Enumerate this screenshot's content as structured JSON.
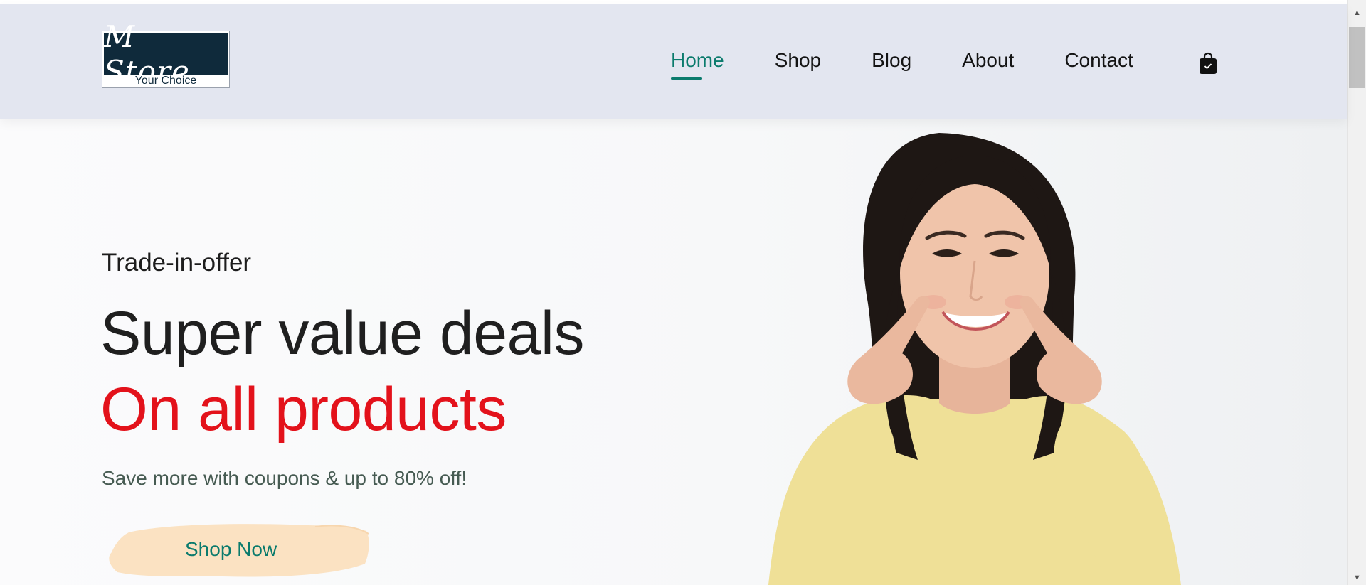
{
  "logo": {
    "name": "M Store",
    "tagline": "Your Choice"
  },
  "nav": {
    "items": [
      {
        "label": "Home",
        "active": true
      },
      {
        "label": "Shop",
        "active": false
      },
      {
        "label": "Blog",
        "active": false
      },
      {
        "label": "About",
        "active": false
      },
      {
        "label": "Contact",
        "active": false
      }
    ],
    "cart_icon": "shopping-bag-icon"
  },
  "hero": {
    "eyebrow": "Trade-in-offer",
    "headline": "Super value deals",
    "headline_accent": "On all products",
    "subtext": "Save more with coupons & up to 80% off!",
    "cta_label": "Shop Now"
  },
  "colors": {
    "accent": "#0b7b6d",
    "highlight": "#e3121b",
    "navbar_bg": "#e3e6f0",
    "cta_brush": "#fbe2c2"
  }
}
